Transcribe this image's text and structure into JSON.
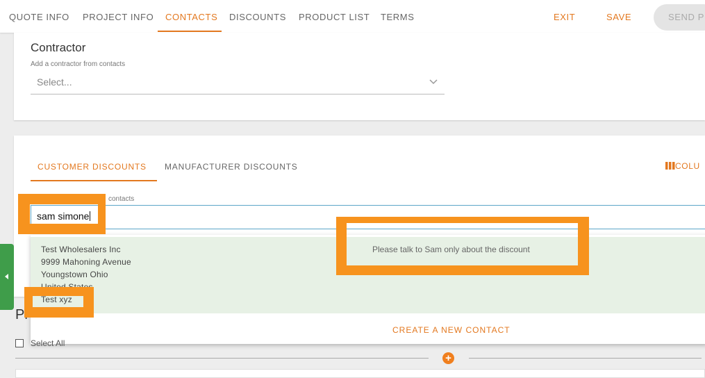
{
  "nav": {
    "tabs": [
      {
        "label": "QUOTE INFO"
      },
      {
        "label": "PROJECT INFO"
      },
      {
        "label": "CONTACTS"
      },
      {
        "label": "DISCOUNTS"
      },
      {
        "label": "PRODUCT LIST"
      },
      {
        "label": "TERMS"
      }
    ],
    "exit_label": "EXIT",
    "save_label": "SAVE",
    "send_label": "SEND P"
  },
  "contractor": {
    "title": "Contractor",
    "subtitle": "Add a contractor from contacts",
    "select_placeholder": "Select..."
  },
  "discounts": {
    "tabs": [
      {
        "label": "CUSTOMER DISCOUNTS"
      },
      {
        "label": "MANUFACTURER DISCOUNTS"
      }
    ],
    "columns_label": "COLU",
    "search_label": "contacts",
    "search_value": "sam simone"
  },
  "dropdown": {
    "result": {
      "name": "Test  Wholesalers Inc",
      "street": "9999 Mahoning Avenue",
      "city": "Youngstown Ohio",
      "country": "United States",
      "extra": "Test xyz",
      "note": "Please talk to Sam only about the discount"
    },
    "create_label": "CREATE A NEW CONTACT"
  },
  "lower": {
    "heading": "Pr",
    "select_all": "Select All"
  },
  "colors": {
    "accent": "#e3781f",
    "highlight": "#f7931e",
    "result_bg": "#e7f1e5",
    "side_handle": "#3f9d4a"
  }
}
